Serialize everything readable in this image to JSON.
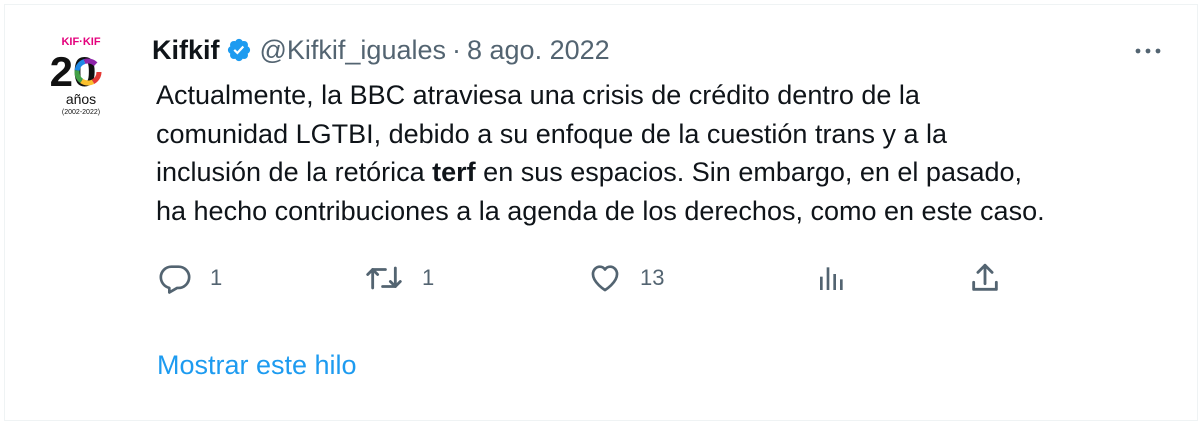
{
  "tweet": {
    "author_name": "Kifkif",
    "handle": "@Kifkif_iguales",
    "separator": "·",
    "date": "8 ago. 2022",
    "avatar": {
      "top_text": "KIF·KIF",
      "number": "20",
      "years": "años",
      "range": "(2002-2022)"
    },
    "text_line1": "Actualmente, la BBC atraviesa una crisis de crédito dentro de la",
    "text_line2": "comunidad LGTBI, debido a su enfoque de la cuestión trans y a la",
    "text_line3a": "inclusión de la retórica ",
    "text_line3_bold": "terf",
    "text_line3b": " en sus espacios. Sin embargo, en el pasado,",
    "text_line4": "ha hecho contribuciones a la agenda de los derechos, como en este caso."
  },
  "actions": {
    "reply_count": "1",
    "retweet_count": "1",
    "like_count": "13",
    "reply_icon": "reply-icon",
    "retweet_icon": "retweet-icon",
    "like_icon": "heart-icon",
    "analytics_icon": "analytics-icon",
    "share_icon": "share-icon"
  },
  "show_thread_label": "Mostrar este hilo",
  "colors": {
    "text": "#0f1419",
    "secondary": "#536471",
    "link": "#1d9bf0",
    "verified": "#1d9bf0"
  }
}
